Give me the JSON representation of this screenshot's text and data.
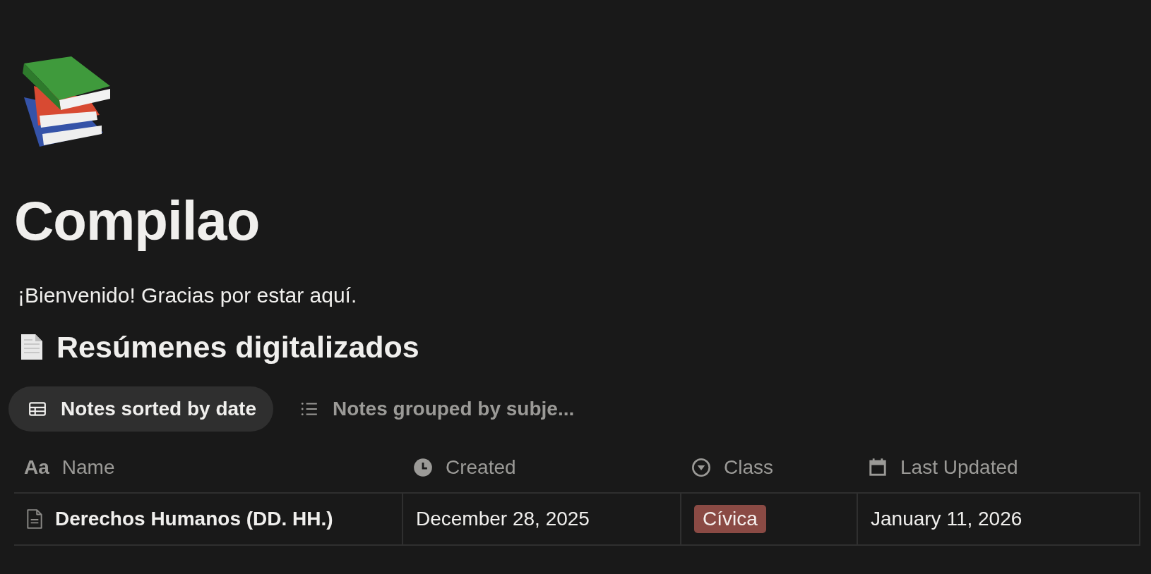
{
  "page": {
    "title": "Compilao",
    "description": "¡Bienvenido! Gracias por estar aquí."
  },
  "database": {
    "title": "Resúmenes digitalizados",
    "views": [
      {
        "label": "Notes sorted by date",
        "kind": "table",
        "selected": true
      },
      {
        "label": "Notes grouped by subje...",
        "kind": "list",
        "selected": false
      }
    ],
    "columns": [
      {
        "label": "Name",
        "kind": "text",
        "icon_text": "Aa"
      },
      {
        "label": "Created",
        "kind": "created"
      },
      {
        "label": "Class",
        "kind": "select"
      },
      {
        "label": "Last Updated",
        "kind": "date"
      }
    ],
    "rows": [
      {
        "name": "Derechos Humanos (DD. HH.)",
        "created": "December 28, 2025",
        "class": {
          "label": "Cívica",
          "color": "#8a4a44"
        },
        "last_updated": "January 11, 2026"
      }
    ]
  }
}
